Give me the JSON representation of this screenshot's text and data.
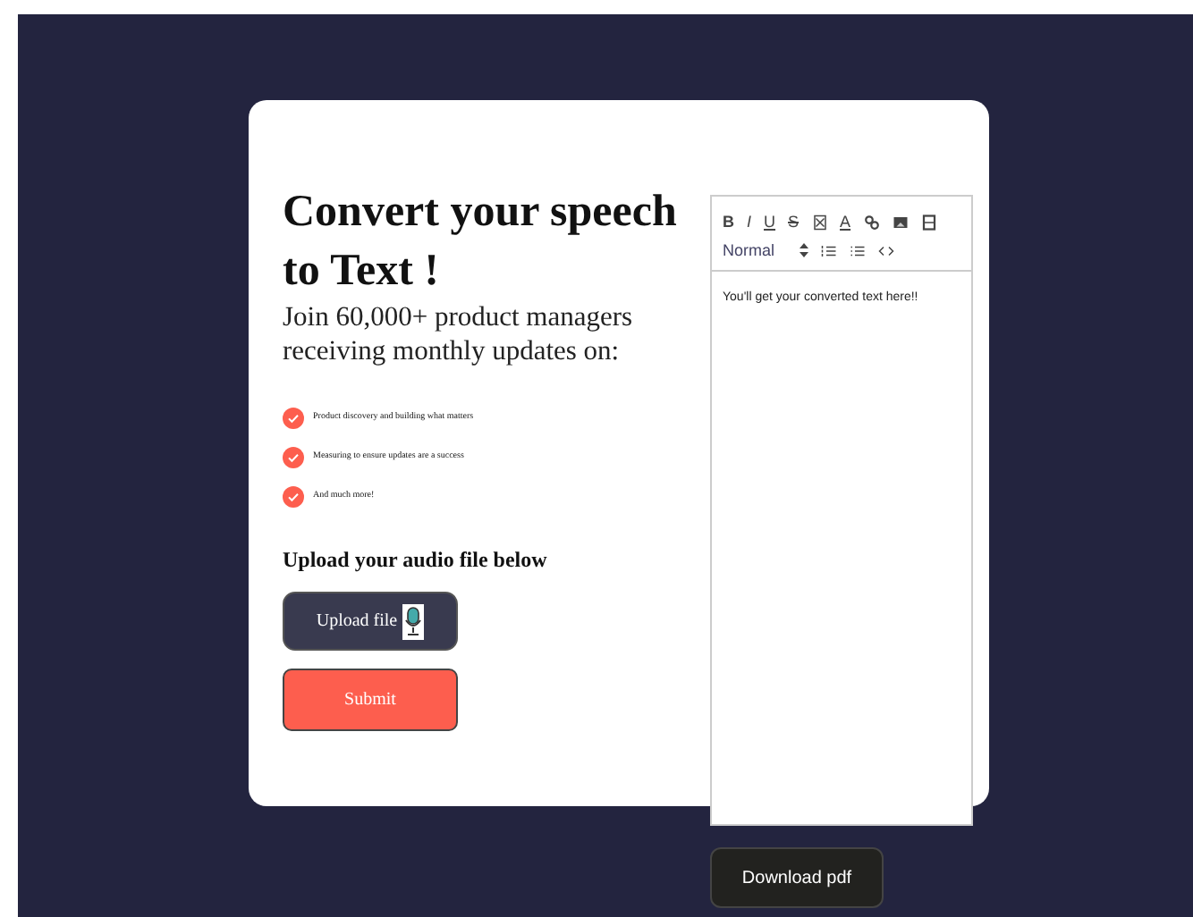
{
  "heading": "Convert your speech to Text !",
  "subheading": "Join 60,000+ product managers receiving monthly updates on:",
  "features": [
    {
      "text": "Product discovery and building what matters"
    },
    {
      "text": "Measuring to ensure updates are a success"
    },
    {
      "text": "And much more!"
    }
  ],
  "upload_label": "Upload your audio file below",
  "upload_button": "Upload file",
  "submit_button": "Submit",
  "editor": {
    "toolbar": [
      {
        "kind": "bold",
        "label": "B"
      },
      {
        "kind": "italic",
        "label": "I"
      },
      {
        "kind": "underline",
        "label": "U"
      },
      {
        "kind": "strike",
        "label": "S"
      },
      {
        "kind": "clean"
      },
      {
        "kind": "color",
        "label": "A"
      },
      {
        "kind": "link"
      },
      {
        "kind": "image"
      },
      {
        "kind": "video"
      },
      {
        "kind": "select",
        "label": "Normal"
      },
      {
        "kind": "ordered"
      },
      {
        "kind": "bullet"
      },
      {
        "kind": "code"
      }
    ],
    "content": "You'll get your converted text here!!"
  },
  "download_button": "Download pdf"
}
